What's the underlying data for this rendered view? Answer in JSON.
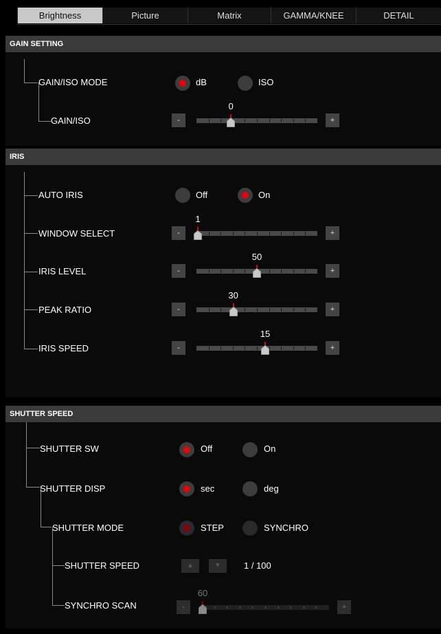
{
  "tabs": [
    "Brightness",
    "Picture",
    "Matrix",
    "GAMMA/KNEE",
    "DETAIL"
  ],
  "active_tab": "Brightness",
  "gain": {
    "header": "GAIN SETTING",
    "mode_label": "GAIN/ISO MODE",
    "mode_options": [
      "dB",
      "ISO"
    ],
    "mode_selected": "dB",
    "gain_label": "GAIN/ISO",
    "gain_value": "0",
    "gain_level": 0.28
  },
  "iris": {
    "header": "IRIS",
    "auto_label": "AUTO IRIS",
    "auto_options": [
      "Off",
      "On"
    ],
    "auto_selected": "On",
    "window_label": "WINDOW SELECT",
    "window_value": "1",
    "window_level": 0.0,
    "level_label": "IRIS LEVEL",
    "level_value": "50",
    "level_level": 0.5,
    "peak_label": "PEAK RATIO",
    "peak_value": "30",
    "peak_level": 0.3,
    "speed_label": "IRIS SPEED",
    "speed_value": "15",
    "speed_level": 0.57
  },
  "shutter": {
    "header": "SHUTTER SPEED",
    "sw_label": "SHUTTER SW",
    "sw_options": [
      "Off",
      "On"
    ],
    "sw_selected": "Off",
    "disp_label": "SHUTTER DISP",
    "disp_options": [
      "sec",
      "deg"
    ],
    "disp_selected": "sec",
    "mode_label": "SHUTTER MODE",
    "mode_options": [
      "STEP",
      "SYNCHRO"
    ],
    "mode_selected": "STEP",
    "speed_label": "SHUTTER SPEED",
    "speed_value": "1 / 100",
    "synchro_label": "SYNCHRO SCAN",
    "synchro_value": "60",
    "synchro_level": 0.0
  },
  "buttons": {
    "minus": "-",
    "plus": "+",
    "up": "▲",
    "down": "▼"
  }
}
